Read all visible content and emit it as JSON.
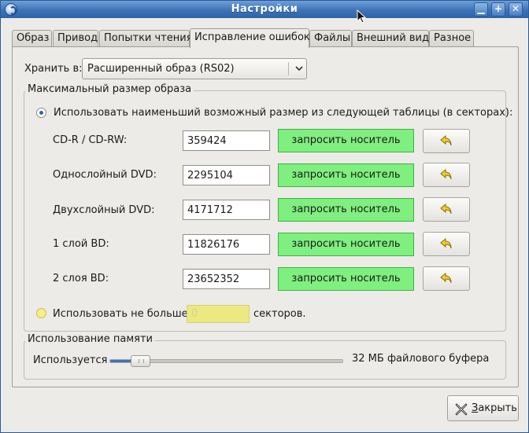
{
  "window": {
    "title": "Настройки",
    "buttons": {
      "minimize": "▁",
      "maximize": "+",
      "close": "✕"
    }
  },
  "tabs": [
    {
      "label": "Образ"
    },
    {
      "label": "Привод"
    },
    {
      "label": "Попытки чтения"
    },
    {
      "label": "Исправление ошибок",
      "active": true
    },
    {
      "label": "Файлы"
    },
    {
      "label": "Внешний вид"
    },
    {
      "label": "Разное"
    }
  ],
  "store": {
    "label": "Хранить в:",
    "selected": "Расширенный образ (RS02)"
  },
  "max_size": {
    "frame_title": "Максимальный размер образа",
    "option_table": "Использовать наименьший возможный размер из следующей таблицы (в секторах):",
    "rows": [
      {
        "label": "CD-R / CD-RW:",
        "value": "359424",
        "button": "запросить носитель"
      },
      {
        "label": "Однослойный DVD:",
        "value": "2295104",
        "button": "запросить носитель"
      },
      {
        "label": "Двухслойный DVD:",
        "value": "4171712",
        "button": "запросить носитель"
      },
      {
        "label": "1 слой BD:",
        "value": "11826176",
        "button": "запросить носитель"
      },
      {
        "label": "2 слоя BD:",
        "value": "23652352",
        "button": "запросить носитель"
      }
    ],
    "option_limit_prefix": "Использовать не больше",
    "option_limit_value": "0",
    "option_limit_suffix": "секторов."
  },
  "memory": {
    "frame_title": "Использование памяти",
    "label": "Используется",
    "slider_fraction": 0.1,
    "value_text": "32 МБ файлового буфера"
  },
  "footer": {
    "close_mnemonic": "З",
    "close_rest": "акрыть"
  },
  "colors": {
    "titlebar": "#3d72b6",
    "query_button": "#7fef7f",
    "radio_selected": "#2f66ad",
    "disabled_entry": "#ece882"
  }
}
